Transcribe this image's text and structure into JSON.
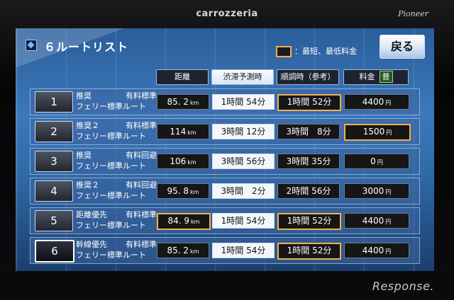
{
  "brand": "carrozzeria",
  "maker": "Pioneer",
  "screen": {
    "title": "６ルートリスト",
    "legend_text": "：最短、最低料金",
    "back_label": "戻る"
  },
  "headers": {
    "distance": "距離",
    "congestion": "渋滞予測時",
    "smooth": "順調時（参考）",
    "fee": "料金",
    "fee_badge": "普"
  },
  "routes": [
    {
      "num": "1",
      "line1": "推奨",
      "line1b": "有料標準",
      "line2": "フェリー標準ルート",
      "distance": "85. 2",
      "distance_unit": "km",
      "congestion": "1時間 54分",
      "smooth": "1時間 52分",
      "fee": "4400",
      "fee_unit": "円"
    },
    {
      "num": "2",
      "line1": "推奨２",
      "line1b": "有料標準",
      "line2": "フェリー標準ルート",
      "distance": "114",
      "distance_unit": "km",
      "congestion": "3時間 12分",
      "smooth": "3時間　8分",
      "fee": "1500",
      "fee_unit": "円"
    },
    {
      "num": "3",
      "line1": "推奨",
      "line1b": "有料回避",
      "line2": "フェリー標準ルート",
      "distance": "106",
      "distance_unit": "km",
      "congestion": "3時間 56分",
      "smooth": "3時間 35分",
      "fee": "0",
      "fee_unit": "円"
    },
    {
      "num": "4",
      "line1": "推奨２",
      "line1b": "有料回避",
      "line2": "フェリー標準ルート",
      "distance": "95. 8",
      "distance_unit": "km",
      "congestion": "3時間　2分",
      "smooth": "2時間 56分",
      "fee": "3000",
      "fee_unit": "円"
    },
    {
      "num": "5",
      "line1": "距離優先",
      "line1b": "有料標準",
      "line2": "フェリー標準ルート",
      "distance": "84. 9",
      "distance_unit": "km",
      "congestion": "1時間 54分",
      "smooth": "1時間 52分",
      "fee": "4400",
      "fee_unit": "円"
    },
    {
      "num": "6",
      "line1": "幹線優先",
      "line1b": "有料標準",
      "line2": "フェリー標準ルート",
      "distance": "85. 2",
      "distance_unit": "km",
      "congestion": "1時間 54分",
      "smooth": "1時間 52分",
      "fee": "4400",
      "fee_unit": "円"
    }
  ],
  "watermark": "Response."
}
